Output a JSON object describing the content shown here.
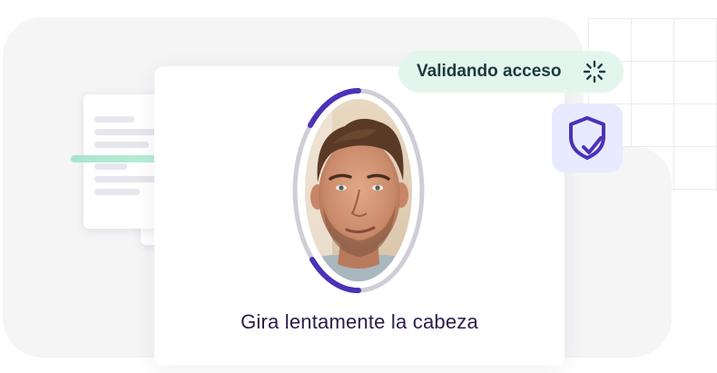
{
  "status": {
    "label": "Validando acceso",
    "state_icon": "loading-spinner-icon",
    "pill_color": "#e3f6ee",
    "text_color": "#1e3a3c"
  },
  "verification": {
    "instruction": "Gira lentamente la cabeza",
    "badge_icon": "shield-check-icon",
    "accent_color": "#4b32b8"
  },
  "colors": {
    "background_panel": "#f5f5f6",
    "scan_line": "#9fe3c7",
    "badge_bg": "#e8eaff"
  }
}
